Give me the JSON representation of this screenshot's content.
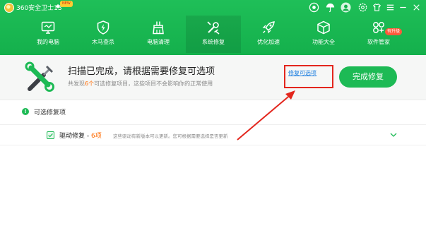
{
  "titlebar": {
    "app_title": "360安全卫士13",
    "diamond": "◆",
    "new_badge": "NEW",
    "icons": [
      "shield-sync-icon",
      "umbrella-icon",
      "user-avatar-icon",
      "settings-icon",
      "skin-icon",
      "menu-icon",
      "minimize-icon",
      "close-icon"
    ]
  },
  "nav": {
    "items": [
      {
        "label": "我的电脑",
        "icon": "monitor-icon"
      },
      {
        "label": "木马查杀",
        "icon": "shield-lightning-icon"
      },
      {
        "label": "电脑清理",
        "icon": "broom-icon"
      },
      {
        "label": "系统修复",
        "icon": "wrench-screwdriver-icon",
        "active": true
      },
      {
        "label": "优化加速",
        "icon": "rocket-icon"
      },
      {
        "label": "功能大全",
        "icon": "cube-icon"
      },
      {
        "label": "软件管家",
        "icon": "software-grid-icon"
      }
    ],
    "upgrade_badge": "有升级"
  },
  "banner": {
    "title": "扫描已完成，请根据需要修复可选项",
    "sub_prefix": "共发现",
    "sub_count": "6个",
    "sub_suffix": "可选修复项目，这些项目不会影响你的正常使用",
    "optional_link": "修复可选项",
    "complete_button": "完成修复"
  },
  "section": {
    "title": "可选修复项",
    "info_glyph": "!"
  },
  "rows": [
    {
      "title": "驱动修复",
      "separator": " - ",
      "count": "6项",
      "description": "这些驱动有新版本可以更新。您可根据需要选择是否更新"
    }
  ],
  "colors": {
    "brand_green": "#1dba55",
    "header_green": "#14b04c",
    "highlight_red": "#e3261d",
    "count_orange": "#ff6a00",
    "link_blue": "#1e7fe0"
  }
}
